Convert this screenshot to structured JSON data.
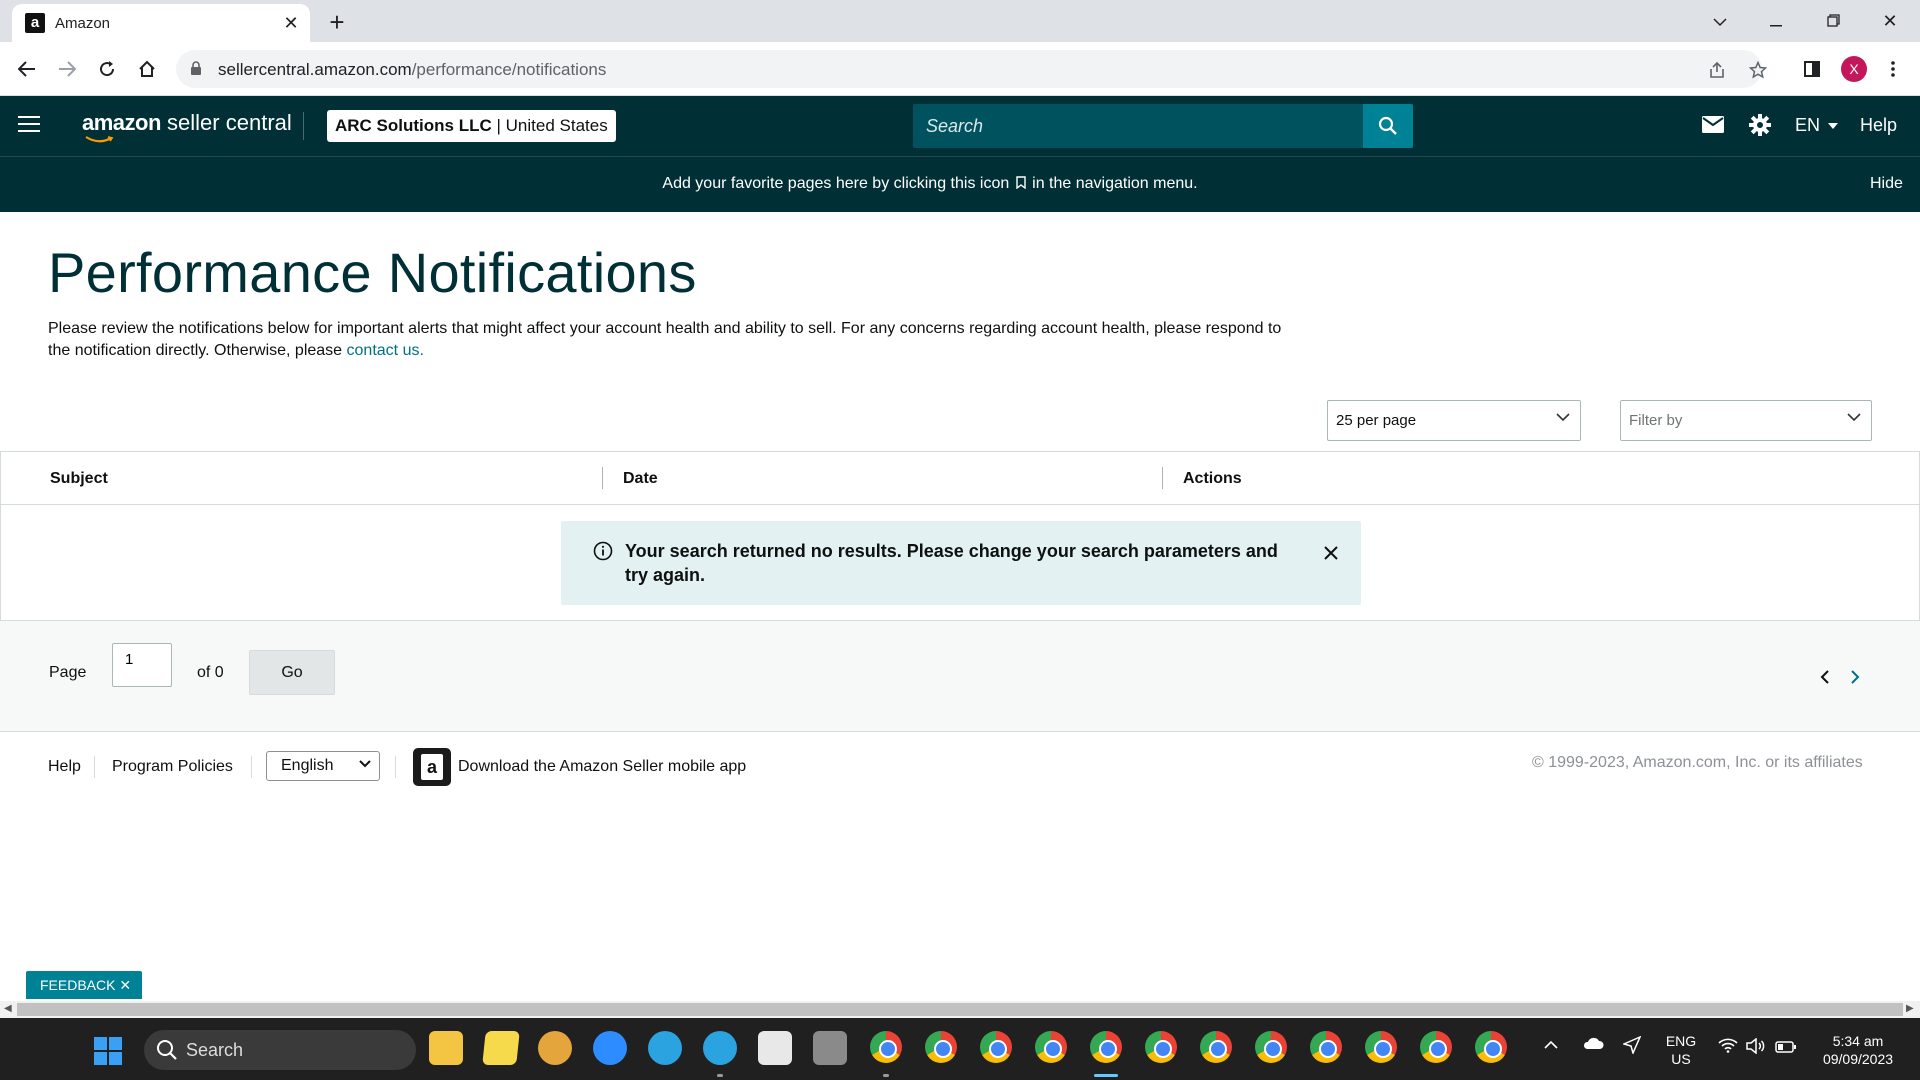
{
  "browser": {
    "tab_title": "Amazon",
    "favicon_letter": "a",
    "url_host": "sellercentral.amazon.com",
    "url_path": "/performance/notifications",
    "profile_initial": "X"
  },
  "header": {
    "logo_brand": "amazon",
    "logo_product": "seller central",
    "account_name": "ARC Solutions LLC",
    "account_separator": "|",
    "account_region": "United States",
    "search_placeholder": "Search",
    "language": "EN",
    "help": "Help"
  },
  "banner": {
    "text_before": "Add your favorite pages here by clicking this icon",
    "text_after": "in the navigation menu.",
    "hide": "Hide"
  },
  "page": {
    "title": "Performance Notifications",
    "intro": "Please review the notifications below for important alerts that might affect your account health and ability to sell. For any concerns regarding account health, please respond to the notification directly. Otherwise, please",
    "contact_link": "contact us.",
    "per_page": "25 per page",
    "filter_placeholder": "Filter by"
  },
  "table": {
    "columns": [
      "Subject",
      "Date",
      "Actions"
    ],
    "alert": "Your search returned no results. Please change your search parameters and try again."
  },
  "pager": {
    "page_label": "Page",
    "page_value": "1",
    "of_label": "of 0",
    "go_label": "Go"
  },
  "footer": {
    "help": "Help",
    "policies": "Program Policies",
    "language": "English",
    "app_letter": "a",
    "app_text": "Download the Amazon Seller mobile app",
    "copyright": "© 1999-2023, Amazon.com, Inc. or its affiliates"
  },
  "feedback": {
    "label": "FEEDBACK ✕"
  },
  "taskbar": {
    "search": "Search",
    "lang_top": "ENG",
    "lang_bottom": "US",
    "time": "5:34 am",
    "date": "09/09/2023"
  },
  "colors": {
    "header_bg": "#002f36",
    "accent": "#008296",
    "link": "#007185",
    "alert_bg": "#e3f1f2"
  }
}
